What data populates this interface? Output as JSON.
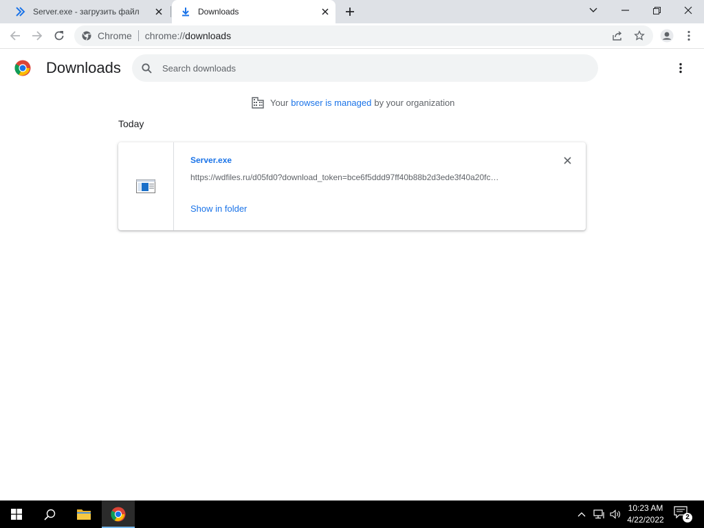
{
  "tabs": [
    {
      "title": "Server.exe - загрузить файл",
      "icon": "forward-chevrons-icon"
    },
    {
      "title": "Downloads",
      "icon": "download-icon",
      "active": true
    }
  ],
  "toolbar": {
    "chip": "Chrome",
    "url_scheme": "chrome://",
    "url_path": "downloads"
  },
  "page": {
    "title": "Downloads",
    "search_placeholder": "Search downloads",
    "managed_prefix": "Your",
    "managed_link": "browser is managed",
    "managed_suffix": "by your organization",
    "section_date": "Today"
  },
  "download": {
    "file_name": "Server.exe",
    "url": "https://wdfiles.ru/d05fd0?download_token=bce6f5ddd97ff40b88b2d3ede3f40a20fc…",
    "action": "Show in folder"
  },
  "taskbar": {
    "time": "10:23 AM",
    "date": "4/22/2022",
    "notification_count": "2"
  },
  "colors": {
    "accent": "#1a73e8",
    "tabstrip": "#dee1e6",
    "omnibox": "#f1f3f4",
    "taskbar": "#000000"
  }
}
